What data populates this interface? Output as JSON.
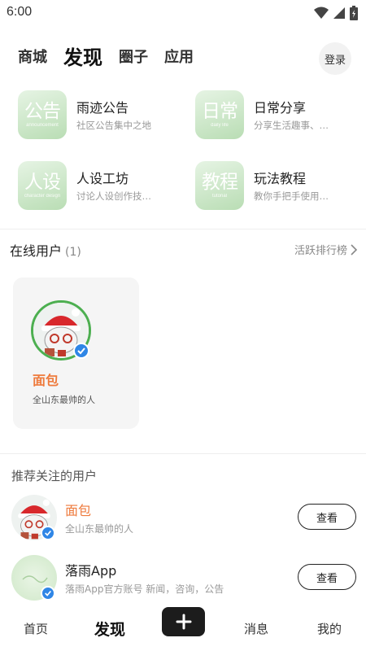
{
  "status": {
    "time": "6:00"
  },
  "top_tabs": [
    {
      "label": "商城",
      "active": false
    },
    {
      "label": "发现",
      "active": true
    },
    {
      "label": "圈子",
      "active": false
    },
    {
      "label": "应用",
      "active": false
    }
  ],
  "login_label": "登录",
  "categories": [
    {
      "icon_text": "公告",
      "icon_sub": "announcement",
      "title": "雨迹公告",
      "desc": "社区公告集中之地"
    },
    {
      "icon_text": "日常",
      "icon_sub": "daily life",
      "title": "日常分享",
      "desc": "分享生活趣事、…"
    },
    {
      "icon_text": "人设",
      "icon_sub": "character design",
      "title": "人设工坊",
      "desc": "讨论人设创作技…"
    },
    {
      "icon_text": "教程",
      "icon_sub": "tutorial",
      "title": "玩法教程",
      "desc": "教你手把手使用…"
    }
  ],
  "online": {
    "title": "在线用户",
    "count": "(1)",
    "rank_label": "活跃排行榜",
    "users": [
      {
        "name": "面包",
        "bio": "全山东最帅的人"
      }
    ]
  },
  "recommend": {
    "title": "推荐关注的用户",
    "users": [
      {
        "name": "面包",
        "bio": "全山东最帅的人",
        "button": "查看",
        "name_color": "#ee7a3c"
      },
      {
        "name": "落雨App",
        "bio": "落雨App官方账号 新闻，咨询，公告",
        "button": "查看",
        "name_color": "#222222"
      }
    ]
  },
  "bottom_nav": [
    {
      "label": "首页",
      "active": false
    },
    {
      "label": "发现",
      "active": true
    },
    {
      "label": "消息",
      "active": false
    },
    {
      "label": "我的",
      "active": false
    }
  ],
  "colors": {
    "accent_name": "#ee7a3c",
    "verified": "#2f86e6",
    "avatar_ring": "#4caf50",
    "category_icon": "#c5e3c1"
  },
  "icons": {
    "wifi": "wifi-icon",
    "signal": "signal-icon",
    "battery": "battery-icon",
    "chevron": "chevron-right-icon",
    "plus": "plus-icon",
    "verified": "verified-icon"
  }
}
